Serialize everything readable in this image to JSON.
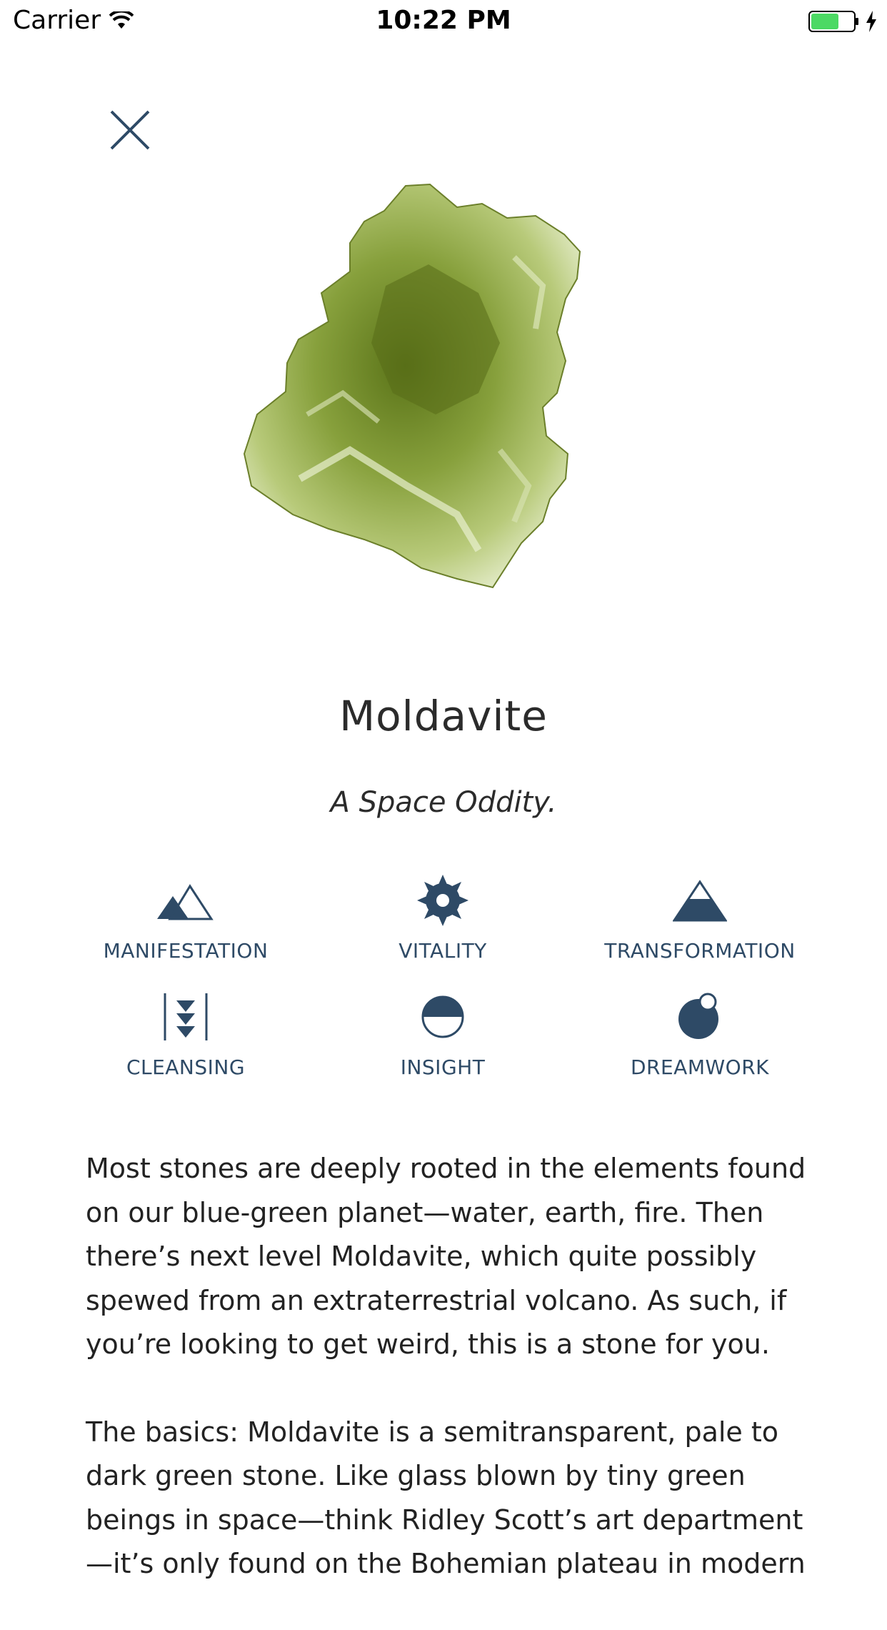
{
  "status_bar": {
    "carrier": "Carrier",
    "time": "10:22 PM",
    "battery_color": "#4cd964"
  },
  "stone": {
    "name": "Moldavite",
    "tagline": "A Space Oddity.",
    "image_icon": "moldavite-stone-image",
    "colors": {
      "accent": "#2e4a66",
      "stone_dark": "#5f7a1e",
      "stone_light": "#c9d898"
    }
  },
  "properties": [
    {
      "label": "MANIFESTATION",
      "icon": "mountains-icon"
    },
    {
      "label": "VITALITY",
      "icon": "sun-icon"
    },
    {
      "label": "TRANSFORMATION",
      "icon": "triangle-icon"
    },
    {
      "label": "CLEANSING",
      "icon": "arrows-down-icon"
    },
    {
      "label": "INSIGHT",
      "icon": "half-circle-icon"
    },
    {
      "label": "DREAMWORK",
      "icon": "moon-orb-icon"
    }
  ],
  "description": {
    "paragraph_1": "Most stones are deeply rooted in the elements found on our blue-green planet—water, earth, fire. Then there’s next level Moldavite, which quite possibly spewed from an extraterrestrial volcano. As such, if you’re looking to get weird, this is a stone for you.",
    "paragraph_2": "The basics: Moldavite is a semitransparent, pale to dark green stone. Like glass blown by tiny green beings in space—think Ridley Scott’s art department —it’s only found on the Bohemian plateau in modern"
  }
}
